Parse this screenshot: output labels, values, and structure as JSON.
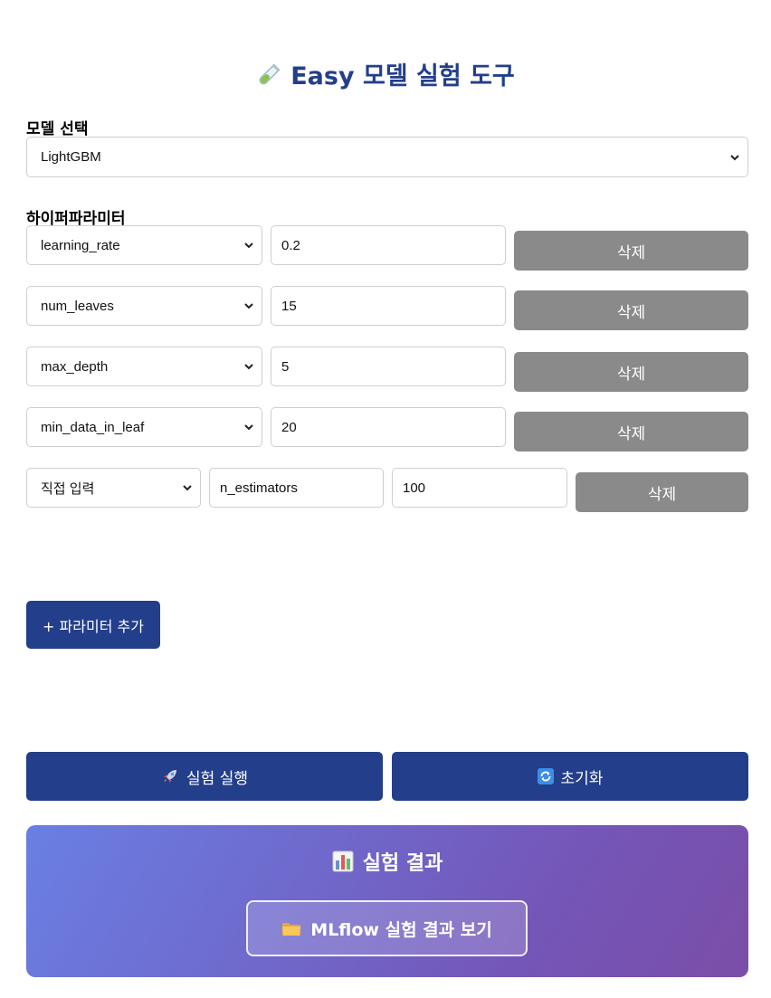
{
  "header": {
    "title": "Easy 모델 실험 도구",
    "icon": "test-tube-icon"
  },
  "model": {
    "label": "모델 선택",
    "selected": "LightGBM"
  },
  "hyperparams": {
    "label": "하이퍼파라미터",
    "rows": [
      {
        "name": "learning_rate",
        "value": "0.2",
        "delete_label": "삭제"
      },
      {
        "name": "num_leaves",
        "value": "15",
        "delete_label": "삭제"
      },
      {
        "name": "max_depth",
        "value": "5",
        "delete_label": "삭제"
      },
      {
        "name": "min_data_in_leaf",
        "value": "20",
        "delete_label": "삭제"
      }
    ],
    "custom_row": {
      "mode": "직접 입력",
      "name": "n_estimators",
      "value": "100",
      "delete_label": "삭제"
    },
    "add_label": "+ 파라미터 추가"
  },
  "actions": {
    "run_label": "실험 실행",
    "run_icon": "rocket-icon",
    "reset_label": "초기화",
    "reset_icon": "refresh-icon"
  },
  "results": {
    "title": "실험 결과",
    "title_icon": "bar-chart-icon",
    "mlflow_label": "MLflow 실험 결과 보기",
    "mlflow_icon": "folder-icon"
  },
  "colors": {
    "primary": "#233e8b",
    "delete": "#8a8a8a",
    "gradient_start": "#6a7fe3",
    "gradient_end": "#7a4ea8"
  }
}
